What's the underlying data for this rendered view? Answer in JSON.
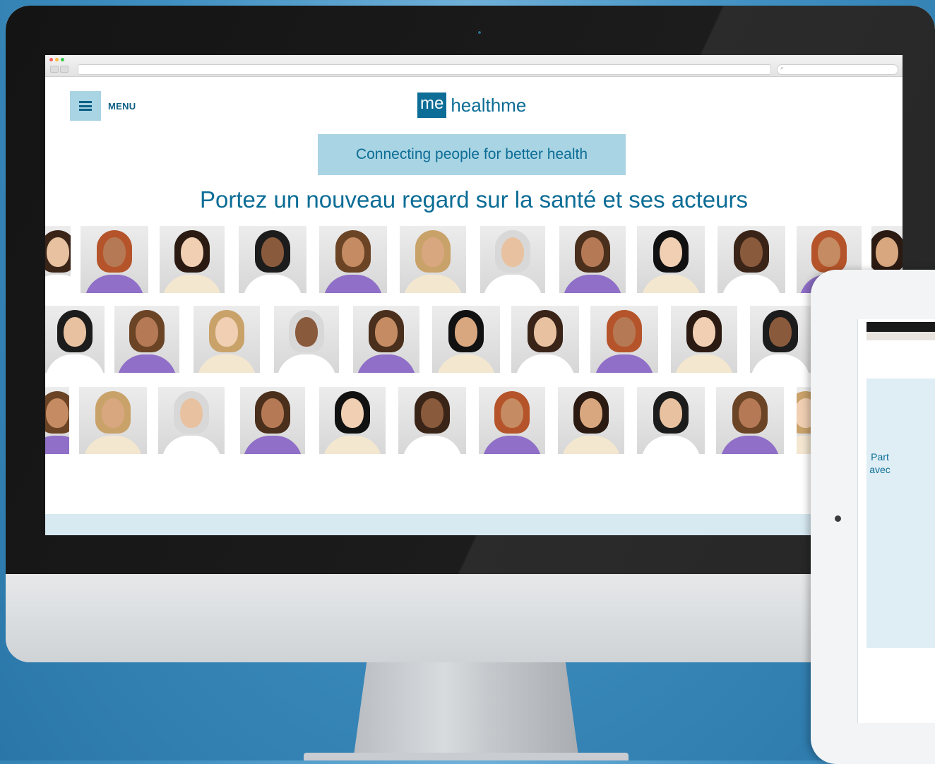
{
  "header": {
    "menu_label": "MENU",
    "logo_box": "me",
    "logo_text": "healthme"
  },
  "hero": {
    "tagline": "Connecting people for better health",
    "headline": "Portez un nouveau regard sur la santé et ses acteurs"
  },
  "browser": {
    "search_glyph": "⌕"
  },
  "tablet": {
    "line1": "Part",
    "line2": "avec"
  },
  "colors": {
    "brand": "#0c6d96",
    "accent_light": "#a9d4e3",
    "background": "#3f8fc1"
  },
  "icons": {
    "menu": "hamburger-icon",
    "camera": "camera-icon",
    "search": "search-icon"
  }
}
